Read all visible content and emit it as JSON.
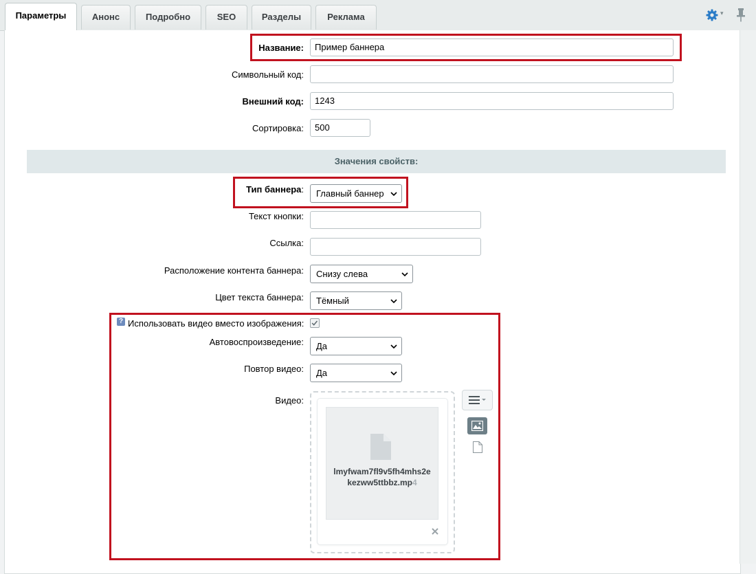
{
  "tabs": [
    {
      "label": "Параметры",
      "active": true
    },
    {
      "label": "Анонс"
    },
    {
      "label": "Подробно"
    },
    {
      "label": "SEO"
    },
    {
      "label": "Разделы"
    },
    {
      "label": "Реклама"
    }
  ],
  "toolbar_icons": [
    "gear-icon",
    "pin-icon"
  ],
  "fields": {
    "name": {
      "label": "Название:",
      "value": "Пример баннера"
    },
    "code": {
      "label": "Символьный код:",
      "value": ""
    },
    "external": {
      "label": "Внешний код:",
      "value": "1243"
    },
    "sort": {
      "label": "Сортировка:",
      "value": "500"
    }
  },
  "properties_header": "Значения свойств:",
  "props": {
    "banner_type": {
      "label": "Тип баннера",
      "colon": ":",
      "value": "Главный баннер"
    },
    "button_text": {
      "label": "Текст кнопки:",
      "value": ""
    },
    "link": {
      "label": "Ссылка:",
      "value": ""
    },
    "content_position": {
      "label": "Расположение контента баннера:",
      "value": "Снизу слева"
    },
    "text_color": {
      "label": "Цвет текста баннера:",
      "value": "Тёмный"
    },
    "use_video": {
      "label": "Использовать видео вместо изображения:",
      "checked": true,
      "help_icon": "?"
    },
    "autoplay": {
      "label": "Автовоспроизведение:",
      "value": "Да"
    },
    "loop": {
      "label": "Повтор видео:",
      "value": "Да"
    },
    "video": {
      "label": "Видео:",
      "file_line1": "lmyfwam7fl9v5fh4mhs2e",
      "file_line2_main": "kezww5ttbbz.mp",
      "file_line2_fade": "4"
    }
  },
  "highlight_color": "#c1121f",
  "accent_color": "#2a7cc7"
}
